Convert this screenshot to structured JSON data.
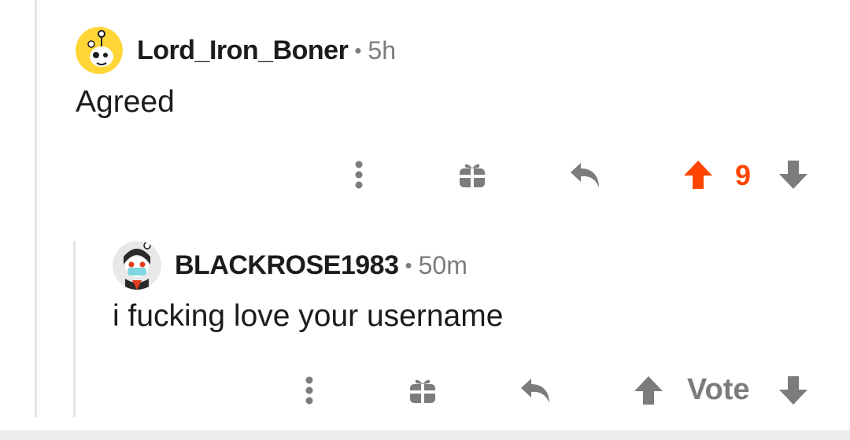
{
  "comments": [
    {
      "username": "Lord_Iron_Boner",
      "separator": "•",
      "time": "5h",
      "body": "Agreed",
      "score": "9",
      "vote_state": "upvoted",
      "colors": {
        "upvote": "#ff4500",
        "downvote": "#7c7c7c"
      },
      "actions": [
        "more-icon",
        "award-icon",
        "reply-icon",
        "upvote-icon",
        "downvote-icon"
      ]
    },
    {
      "username": "BLACKROSE1983",
      "separator": "•",
      "time": "50m",
      "body": "i fucking love your username",
      "score": "Vote",
      "vote_state": "none",
      "colors": {
        "upvote": "#7c7c7c",
        "downvote": "#7c7c7c"
      },
      "actions": [
        "more-icon",
        "award-icon",
        "reply-icon",
        "upvote-icon",
        "downvote-icon"
      ]
    }
  ],
  "theme": {
    "text": "#1c1c1c",
    "meta": "#7c7c7c",
    "accent": "#ff4500",
    "thread_line": "#e5e5e5"
  }
}
